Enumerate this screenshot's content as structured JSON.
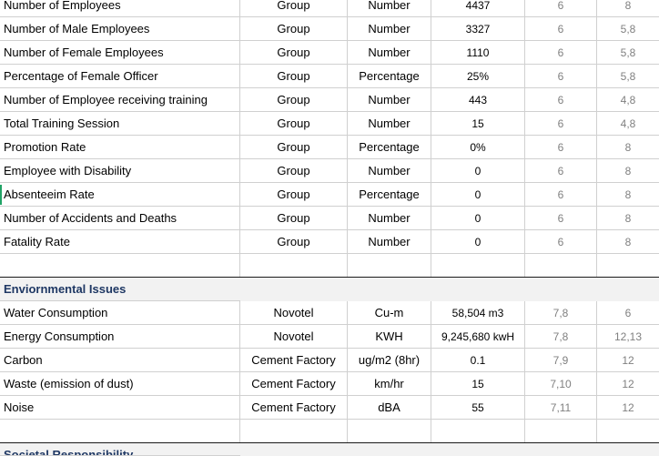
{
  "rows_top": [
    {
      "label": "Number of Employees",
      "scope": "Group",
      "unit": "Number",
      "value": "4437",
      "ref1": "6",
      "ref2": "8"
    },
    {
      "label": "Number of Male Employees",
      "scope": "Group",
      "unit": "Number",
      "value": "3327",
      "ref1": "6",
      "ref2": "5,8"
    },
    {
      "label": "Number of Female Employees",
      "scope": "Group",
      "unit": "Number",
      "value": "1110",
      "ref1": "6",
      "ref2": "5,8"
    },
    {
      "label": "Percentage of Female Officer",
      "scope": "Group",
      "unit": "Percentage",
      "value": "25%",
      "ref1": "6",
      "ref2": "5,8"
    },
    {
      "label": "Number of Employee receiving training",
      "scope": "Group",
      "unit": "Number",
      "value": "443",
      "ref1": "6",
      "ref2": "4,8"
    },
    {
      "label": "Total Training Session",
      "scope": "Group",
      "unit": "Number",
      "value": "15",
      "ref1": "6",
      "ref2": "4,8"
    },
    {
      "label": "Promotion Rate",
      "scope": "Group",
      "unit": "Percentage",
      "value": "0%",
      "ref1": "6",
      "ref2": "8"
    },
    {
      "label": "Employee with Disability",
      "scope": "Group",
      "unit": "Number",
      "value": "0",
      "ref1": "6",
      "ref2": "8"
    },
    {
      "label": "Absenteeim Rate",
      "scope": "Group",
      "unit": "Percentage",
      "value": "0",
      "ref1": "6",
      "ref2": "8"
    },
    {
      "label": "Number of Accidents and Deaths",
      "scope": "Group",
      "unit": "Number",
      "value": "0",
      "ref1": "6",
      "ref2": "8"
    },
    {
      "label": "Fatality Rate",
      "scope": "Group",
      "unit": "Number",
      "value": "0",
      "ref1": "6",
      "ref2": "8"
    }
  ],
  "env_section_title": "Enviornmental Issues",
  "rows_env": [
    {
      "label": "Water Consumption",
      "scope": "Novotel",
      "unit": "Cu-m",
      "value": "58,504 m3",
      "ref1": "7,8",
      "ref2": "6"
    },
    {
      "label": "Energy Consumption",
      "scope": "Novotel",
      "unit": "KWH",
      "value": "9,245,680 kwH",
      "ref1": "7,8",
      "ref2": "12,13"
    },
    {
      "label": "Carbon",
      "scope": "Cement Factory",
      "unit": "ug/m2 (8hr)",
      "value": "0.1",
      "ref1": "7,9",
      "ref2": "12"
    },
    {
      "label": "Waste (emission of dust)",
      "scope": "Cement Factory",
      "unit": "km/hr",
      "value": "15",
      "ref1": "7,10",
      "ref2": "12"
    },
    {
      "label": "Noise",
      "scope": "Cement Factory",
      "unit": "dBA",
      "value": "55",
      "ref1": "7,11",
      "ref2": "12"
    }
  ],
  "societal_section_title": "Societal Responsibility"
}
